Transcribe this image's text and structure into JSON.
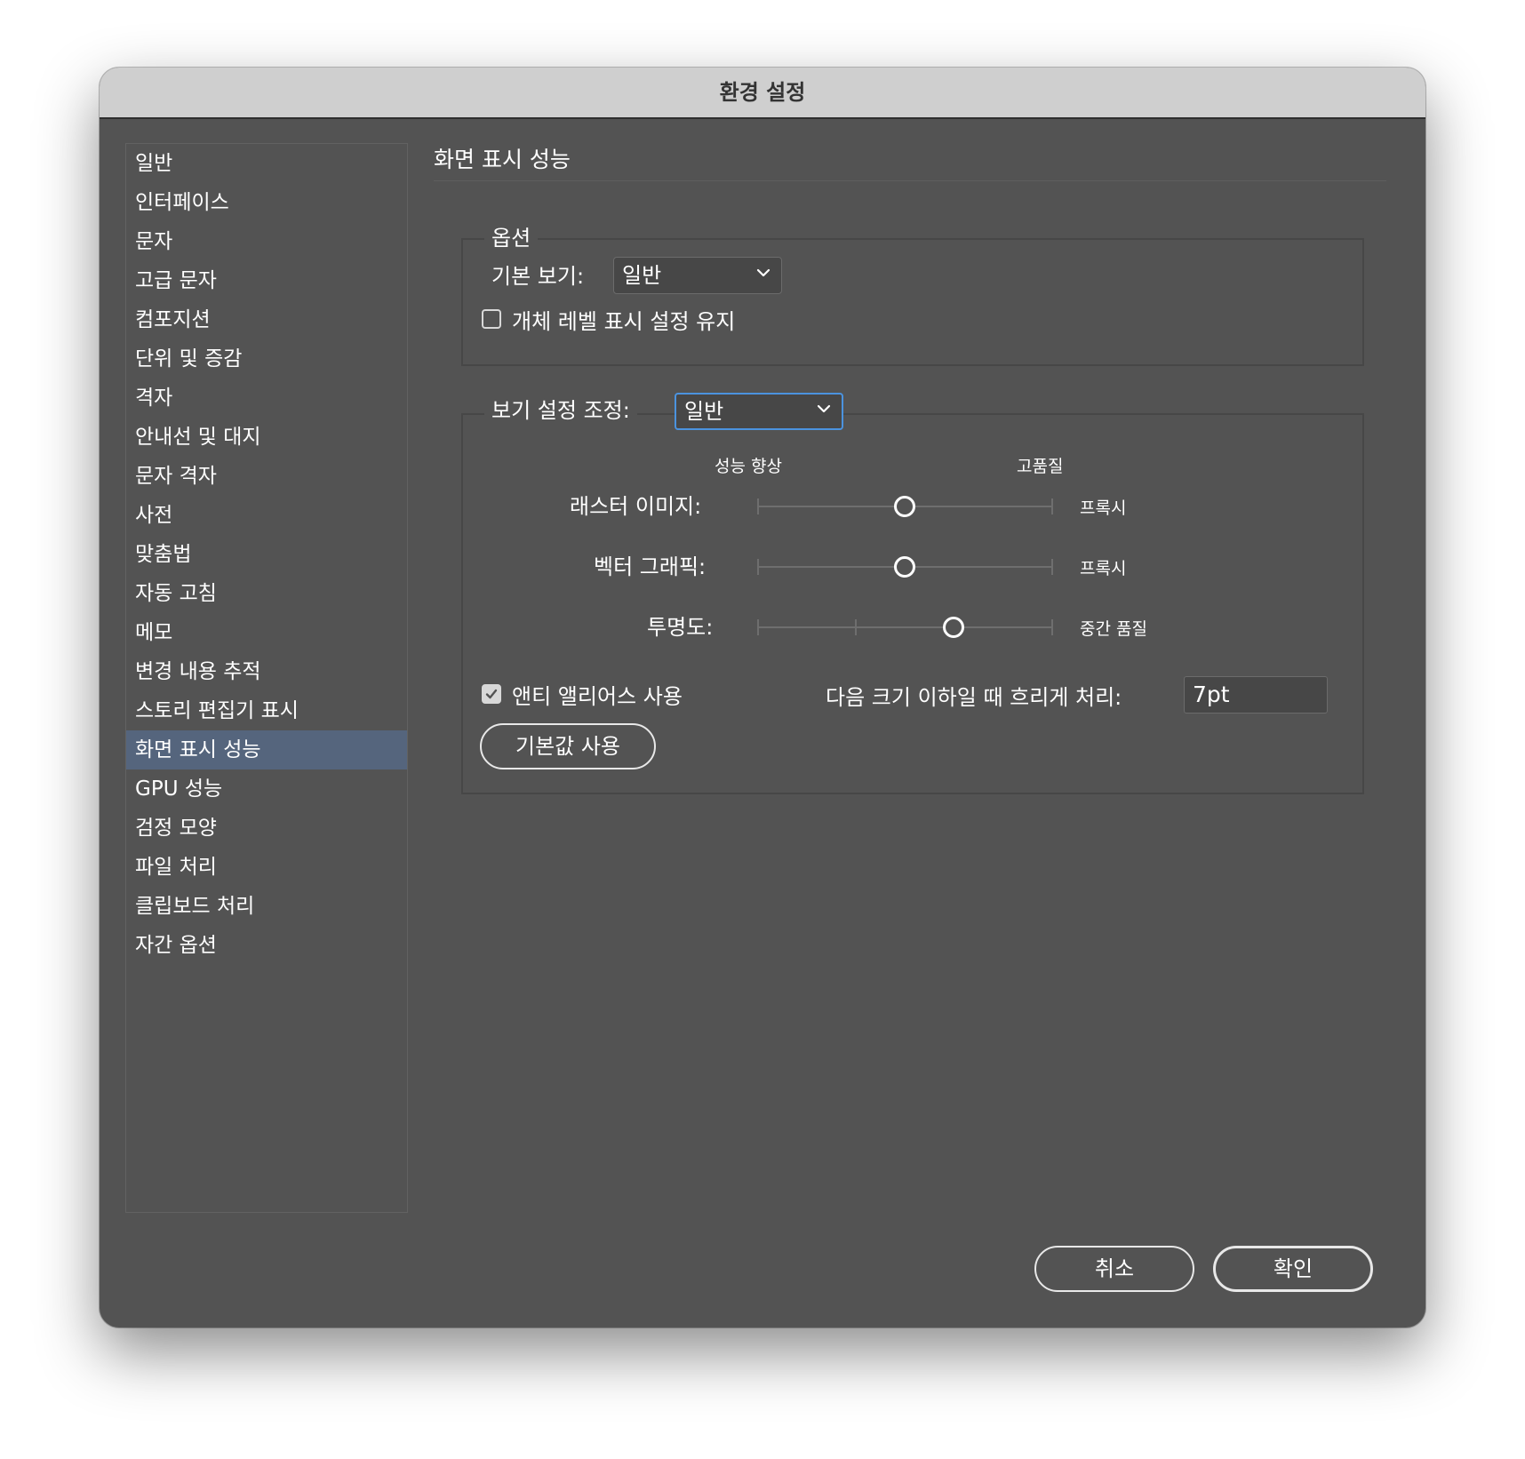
{
  "window": {
    "title": "환경 설정"
  },
  "sidebar": {
    "items": [
      {
        "label": "일반"
      },
      {
        "label": "인터페이스"
      },
      {
        "label": "문자"
      },
      {
        "label": "고급 문자"
      },
      {
        "label": "컴포지션"
      },
      {
        "label": "단위 및 증감"
      },
      {
        "label": "격자"
      },
      {
        "label": "안내선 및 대지"
      },
      {
        "label": "문자 격자"
      },
      {
        "label": "사전"
      },
      {
        "label": "맞춤법"
      },
      {
        "label": "자동 고침"
      },
      {
        "label": "메모"
      },
      {
        "label": "변경 내용 추적"
      },
      {
        "label": "스토리 편집기 표시"
      },
      {
        "label": "화면 표시 성능",
        "selected": true
      },
      {
        "label": "GPU 성능"
      },
      {
        "label": "검정 모양"
      },
      {
        "label": "파일 처리"
      },
      {
        "label": "클립보드 처리"
      },
      {
        "label": "자간 옵션"
      }
    ],
    "selected_color": "#55657d"
  },
  "panel": {
    "title": "화면 표시 성능",
    "options": {
      "legend": "옵션",
      "default_view_label": "기본 보기:",
      "default_view_value": "일반",
      "preserve_object_label": "개체 레벨 표시 설정 유지",
      "preserve_object_checked": false
    },
    "adjust": {
      "label": "보기 설정 조정:",
      "value": "일반",
      "scale_left": "성능 향상",
      "scale_right": "고품질",
      "sliders": [
        {
          "label": "래스터 이미지:",
          "level": 0.5,
          "value_text": "프록시"
        },
        {
          "label": "벡터 그래픽:",
          "level": 0.5,
          "value_text": "프록시"
        },
        {
          "label": "투명도:",
          "level": 0.667,
          "value_text": "중간 품질"
        }
      ],
      "antialias_label": "앤티 앨리어스 사용",
      "antialias_checked": true,
      "greek_label": "다음 크기 이하일 때 흐리게 처리:",
      "greek_value": "7pt",
      "defaults_button": "기본값 사용"
    }
  },
  "footer": {
    "cancel": "취소",
    "ok": "확인"
  },
  "colors": {
    "dialog_bg": "#535353",
    "titlebar_bg": "#cfcfcf",
    "focus_ring": "#4b93df"
  }
}
